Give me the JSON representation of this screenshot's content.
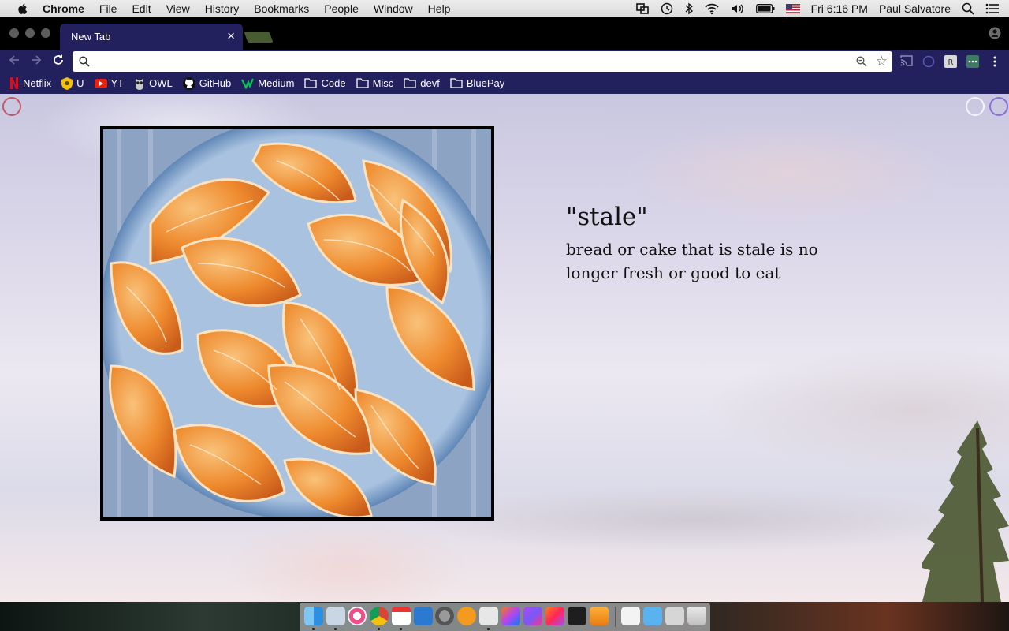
{
  "menubar": {
    "app_name": "Chrome",
    "items": [
      "File",
      "Edit",
      "View",
      "History",
      "Bookmarks",
      "People",
      "Window",
      "Help"
    ],
    "clock": "Fri 6:16 PM",
    "user": "Paul Salvatore",
    "icons": [
      "apple-icon",
      "screen-mirror-icon",
      "time-machine-icon",
      "bluetooth-icon",
      "wifi-icon",
      "volume-icon",
      "battery-icon",
      "flag-icon",
      "spotlight-icon",
      "notification-center-icon"
    ]
  },
  "browser": {
    "tab_title": "New Tab",
    "tab_close": "×",
    "omnibox_value": "",
    "bookmarks": [
      {
        "label": "Netflix",
        "icon": "netflix-icon"
      },
      {
        "label": "U",
        "icon": "shield-icon"
      },
      {
        "label": "YT",
        "icon": "youtube-icon"
      },
      {
        "label": "OWL",
        "icon": "owl-icon"
      },
      {
        "label": "GitHub",
        "icon": "github-icon"
      },
      {
        "label": "Medium",
        "icon": "medium-icon"
      },
      {
        "label": "Code",
        "icon": "folder-icon"
      },
      {
        "label": "Misc",
        "icon": "folder-icon"
      },
      {
        "label": "devf",
        "icon": "folder-icon"
      },
      {
        "label": "BluePay",
        "icon": "folder-icon"
      }
    ],
    "colors": {
      "chrome_theme": "#23205e",
      "tab_inactive": "#475c30"
    }
  },
  "newtab": {
    "word": "\"stale\"",
    "definition": "bread or cake that is stale is no longer fresh or good to eat",
    "painting_subject": "orange-segments-painting"
  },
  "dock": {
    "apps": [
      "finder-icon",
      "preview-icon",
      "itunes-icon",
      "chrome-icon",
      "calendar-icon",
      "word-icon",
      "system-preferences-icon",
      "ibooks-icon",
      "sublime-icon",
      "intellij-icon",
      "phpstorm-icon",
      "rubymine-icon",
      "terminal-icon",
      "sublime-text-icon",
      "document-icon",
      "folder-icon",
      "preview-window-icon",
      "trash-icon"
    ]
  }
}
